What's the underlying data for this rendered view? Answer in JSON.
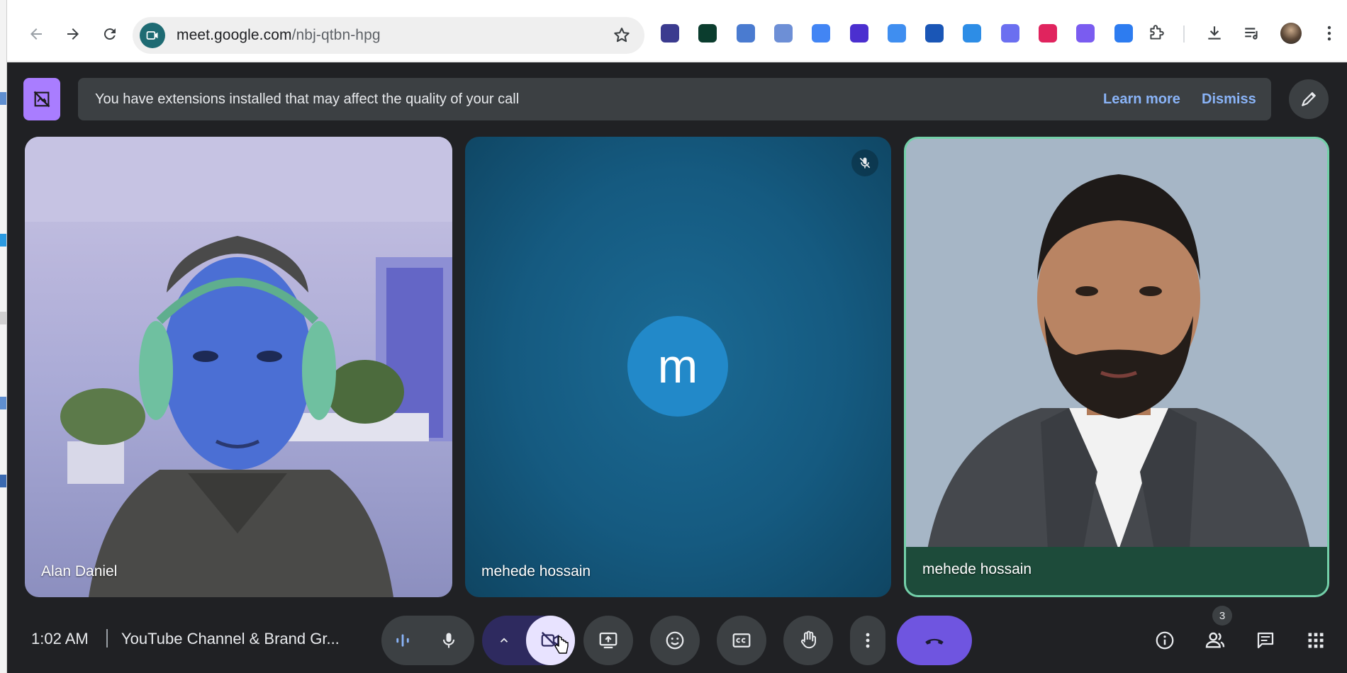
{
  "browser": {
    "url_host": "meet.google.com",
    "url_path": "/nbj-qtbn-hpg",
    "extension_icons": [
      "s-ext-icon",
      "check-ext-icon",
      "la-ext-icon",
      "globe-ext-icon",
      "translate-ext-icon",
      "diamond-ext-icon",
      "tag-ext-icon",
      "checkbox-ext-icon",
      "verified-ext-icon",
      "d-ext-icon",
      "shield-ext-icon",
      "gear-ext-icon",
      "play-ext-icon"
    ],
    "extension_colors": [
      "#3b3b8f",
      "#0b3d2e",
      "#4a7bd0",
      "#6d8fd6",
      "#4285f4",
      "#4b2fcf",
      "#3f8ef0",
      "#1a56b6",
      "#2d8de6",
      "#6b6ff0",
      "#e0245e",
      "#7a5cf0",
      "#2d7cf0"
    ]
  },
  "banner": {
    "message": "You have extensions installed that may affect the quality of your call",
    "learn_more": "Learn more",
    "dismiss": "Dismiss"
  },
  "participants": [
    {
      "name": "Alan Daniel"
    },
    {
      "name": "mehede hossain",
      "initial": "m",
      "muted": true
    },
    {
      "name": "mehede hossain"
    }
  ],
  "controls": {
    "time": "1:02 AM",
    "meeting_title": "YouTube Channel & Brand Gr...",
    "people_count": "3"
  },
  "colors": {
    "accent": "#6f55e0",
    "banner_bg": "#3c4043",
    "active_speaker_border": "#73d0a9",
    "avatar_bg": "#2289c9",
    "camera_off_bg": "#2e2a5f"
  }
}
